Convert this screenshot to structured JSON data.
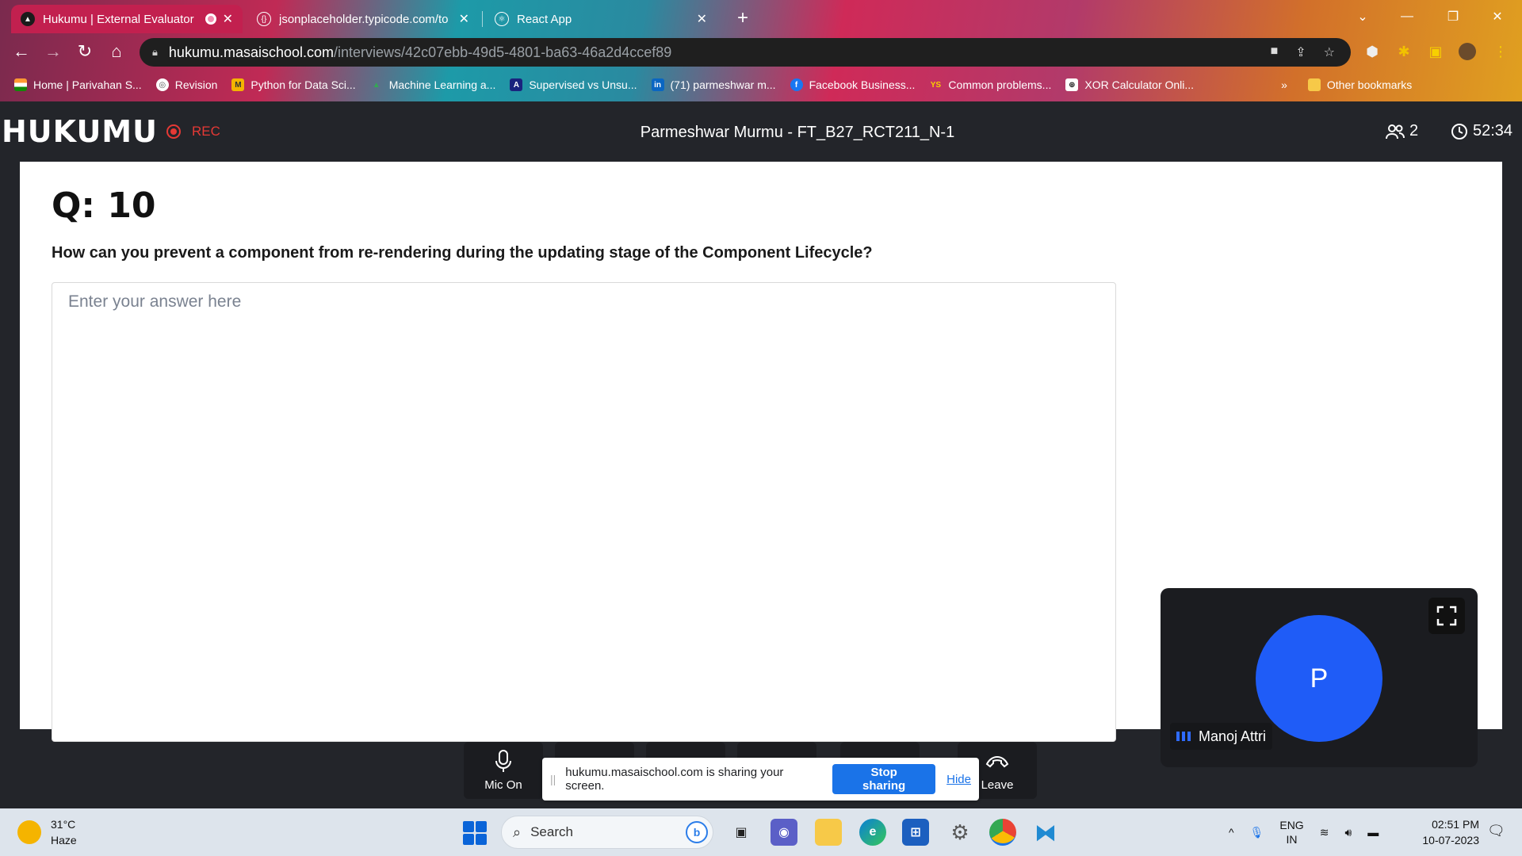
{
  "browser": {
    "tabs": [
      {
        "label": "Hukumu | External Evaluator",
        "active": true
      },
      {
        "label": "jsonplaceholder.typicode.com/to",
        "active": false
      },
      {
        "label": "React App",
        "active": false
      }
    ],
    "url_host": "hukumu.masaischool.com",
    "url_path": "/interviews/42c07ebb-49d5-4801-ba63-46a2d4ccef89",
    "bookmarks": [
      {
        "label": "Home | Parivahan S..."
      },
      {
        "label": "Revision"
      },
      {
        "label": "Python for Data Sci..."
      },
      {
        "label": "Machine Learning a..."
      },
      {
        "label": "Supervised vs Unsu..."
      },
      {
        "label": "(71) parmeshwar m..."
      },
      {
        "label": "Facebook Business..."
      },
      {
        "label": "Common problems..."
      },
      {
        "label": "XOR Calculator Onli..."
      }
    ],
    "bookmarks_overflow": "»",
    "other_bookmarks": "Other bookmarks"
  },
  "app": {
    "logo": "HUKUMU",
    "rec_label": "REC",
    "session_title": "Parmeshwar Murmu - FT_B27_RCT211_N-1",
    "participant_count": "2",
    "timer": "52:34"
  },
  "question": {
    "number": "Q: 10",
    "text": "How can you prevent a component from re-rendering during the updating stage of the Component Lifecycle?",
    "answer_placeholder": "Enter your answer here"
  },
  "video": {
    "avatar_initial": "P",
    "participant_name": "Manoj Attri"
  },
  "controls": {
    "mic_label": "Mic On",
    "leave_label": "Leave"
  },
  "share_banner": {
    "message": "hukumu.masaischool.com is sharing your screen.",
    "stop_label": "Stop sharing",
    "hide_label": "Hide"
  },
  "taskbar": {
    "temperature": "31°C",
    "weather": "Haze",
    "search_placeholder": "Search",
    "lang_top": "ENG",
    "lang_bottom": "IN",
    "time": "02:51 PM",
    "date": "10-07-2023"
  }
}
